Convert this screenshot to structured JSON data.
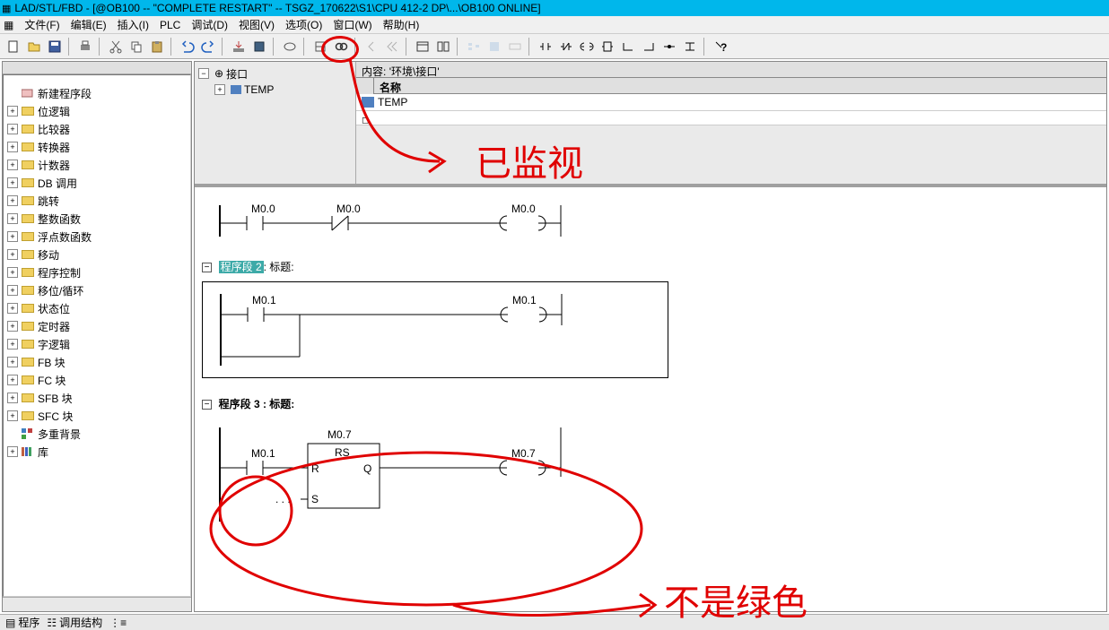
{
  "title": "LAD/STL/FBD  - [@OB100 -- \"COMPLETE RESTART\" -- TSGZ_170622\\S1\\CPU 412-2 DP\\...\\OB100  ONLINE]",
  "menu": {
    "file": "文件(F)",
    "edit": "编辑(E)",
    "insert": "插入(I)",
    "plc": "PLC",
    "debug": "调试(D)",
    "view": "视图(V)",
    "options": "选项(O)",
    "window": "窗口(W)",
    "help": "帮助(H)"
  },
  "sidebar": {
    "items": [
      {
        "exp": "",
        "icon": "new",
        "label": "新建程序段"
      },
      {
        "exp": "+",
        "icon": "folder",
        "label": "位逻辑"
      },
      {
        "exp": "+",
        "icon": "folder",
        "label": "比较器"
      },
      {
        "exp": "+",
        "icon": "folder",
        "label": "转换器"
      },
      {
        "exp": "+",
        "icon": "folder",
        "label": "计数器"
      },
      {
        "exp": "+",
        "icon": "folder",
        "label": "DB 调用"
      },
      {
        "exp": "+",
        "icon": "folder",
        "label": "跳转"
      },
      {
        "exp": "+",
        "icon": "folder",
        "label": "整数函数"
      },
      {
        "exp": "+",
        "icon": "folder",
        "label": "浮点数函数"
      },
      {
        "exp": "+",
        "icon": "folder",
        "label": "移动"
      },
      {
        "exp": "+",
        "icon": "folder",
        "label": "程序控制"
      },
      {
        "exp": "+",
        "icon": "folder",
        "label": "移位/循环"
      },
      {
        "exp": "+",
        "icon": "folder",
        "label": "状态位"
      },
      {
        "exp": "+",
        "icon": "folder",
        "label": "定时器"
      },
      {
        "exp": "+",
        "icon": "folder",
        "label": "字逻辑"
      },
      {
        "exp": "+",
        "icon": "folder",
        "label": "FB 块"
      },
      {
        "exp": "+",
        "icon": "folder",
        "label": "FC 块"
      },
      {
        "exp": "+",
        "icon": "folder",
        "label": "SFB 块"
      },
      {
        "exp": "+",
        "icon": "folder",
        "label": "SFC 块"
      },
      {
        "exp": "",
        "icon": "multi",
        "label": "多重背景"
      },
      {
        "exp": "+",
        "icon": "lib",
        "label": "库"
      }
    ]
  },
  "interface": {
    "root": "接口",
    "temp": "TEMP",
    "content_label": "内容:",
    "content_value": "'环境\\接口'",
    "name_header": "名称",
    "name_value": "TEMP"
  },
  "networks": {
    "n1": {
      "contact1": "M0.0",
      "contact2": "M0.0",
      "coil": "M0.0"
    },
    "n2": {
      "title_prefix": "程序段 2",
      "title_suffix": ": 标题:",
      "contact1": "M0.1",
      "coil": "M0.1"
    },
    "n3": {
      "title": "程序段 3 : 标题:",
      "contact1": "M0.1",
      "block_top": "M0.7",
      "block_name": "RS",
      "block_r": "R",
      "block_s": "S",
      "block_q": "Q",
      "ellipsis": ". . .",
      "coil": "M0.7"
    }
  },
  "bottom": {
    "tab1": "程序",
    "tab2": "调用结构"
  },
  "annotations": {
    "text1": "已监视",
    "text2": "不是绿色"
  }
}
